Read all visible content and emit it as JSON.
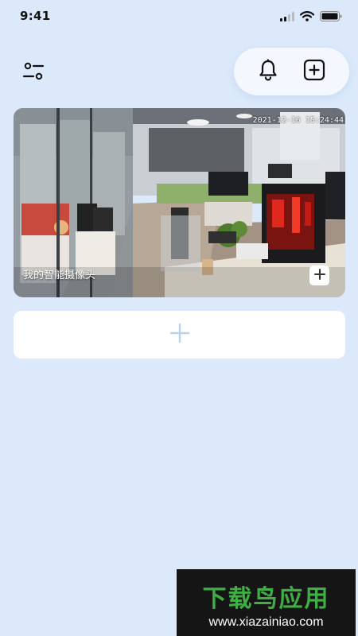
{
  "status_bar": {
    "time": "9:41"
  },
  "header": {
    "filter_icon": "sliders-icon",
    "bell_icon": "bell-icon",
    "add_icon": "plus-square-icon"
  },
  "camera": {
    "name": "我的智能摄像头",
    "timestamp": "2021-12-16 15:24:44",
    "add_icon": "plus-icon"
  },
  "add_device": {
    "icon": "plus-icon"
  },
  "watermark": {
    "title": "下载鸟应用",
    "url": "www.xiazainiao.com"
  },
  "colors": {
    "background": "#dbe9fb",
    "card": "#ffffff",
    "add_plus": "#b9d3ee",
    "watermark_green": "#3fae45"
  }
}
